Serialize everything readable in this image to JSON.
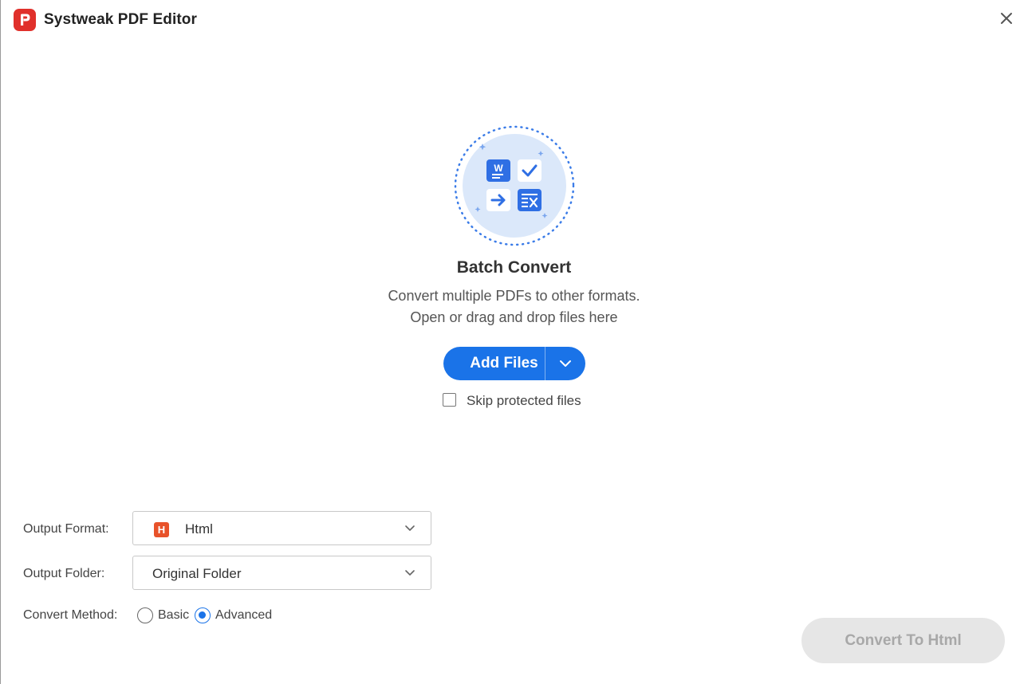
{
  "window": {
    "title": "Systweak PDF Editor"
  },
  "colors": {
    "accent": "#1a73e8",
    "brand_red": "#e0302b",
    "hero_bg": "#dbe8fa",
    "disabled_bg": "#e6e6e6",
    "disabled_text": "#a8a8a8"
  },
  "hero": {
    "heading": "Batch Convert",
    "subtitle_line1": "Convert multiple PDFs to other formats.",
    "subtitle_line2": "Open or drag and drop files here",
    "icons": [
      "word-doc-icon",
      "checkmark-icon",
      "arrow-right-icon",
      "excel-icon"
    ]
  },
  "add_files": {
    "label": "Add Files"
  },
  "skip_protected": {
    "label": "Skip protected files",
    "checked": false
  },
  "output_format": {
    "label": "Output Format:",
    "value": "Html",
    "icon_letter": "H"
  },
  "output_folder": {
    "label": "Output Folder:",
    "value": "Original Folder"
  },
  "convert_method": {
    "label": "Convert Method:",
    "options": [
      "Basic",
      "Advanced"
    ],
    "selected": "Advanced"
  },
  "convert_button": {
    "label": "Convert To Html",
    "enabled": false
  }
}
